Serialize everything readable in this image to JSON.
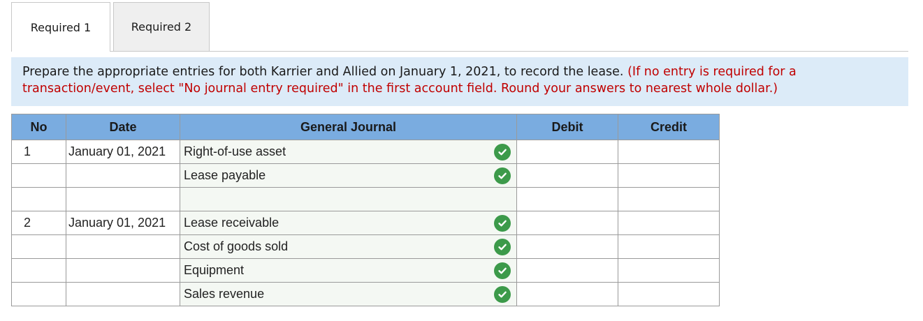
{
  "tabs": [
    {
      "label": "Required 1",
      "active": true
    },
    {
      "label": "Required 2",
      "active": false
    }
  ],
  "instructions": {
    "text": "Prepare the appropriate entries for both Karrier and Allied on January 1, 2021, to record the lease.",
    "note": "(If no entry is required for a transaction/event, select \"No journal entry required\" in the first account field. Round your answers to nearest whole dollar.)"
  },
  "table": {
    "headers": {
      "no": "No",
      "date": "Date",
      "journal": "General Journal",
      "debit": "Debit",
      "credit": "Credit"
    },
    "rows": [
      {
        "no": "1",
        "date": "January 01, 2021",
        "account": "Right-of-use asset",
        "debit": "",
        "credit": "",
        "checked": true
      },
      {
        "no": "",
        "date": "",
        "account": "Lease payable",
        "debit": "",
        "credit": "",
        "checked": true
      },
      {
        "no": "",
        "date": "",
        "account": "",
        "debit": "",
        "credit": "",
        "checked": false
      },
      {
        "no": "2",
        "date": "January 01, 2021",
        "account": "Lease receivable",
        "debit": "",
        "credit": "",
        "checked": true
      },
      {
        "no": "",
        "date": "",
        "account": "Cost of goods sold",
        "debit": "",
        "credit": "",
        "checked": true
      },
      {
        "no": "",
        "date": "",
        "account": "Equipment",
        "debit": "",
        "credit": "",
        "checked": true
      },
      {
        "no": "",
        "date": "",
        "account": "Sales revenue",
        "debit": "",
        "credit": "",
        "checked": true
      }
    ]
  },
  "icons": {
    "check": "check-circle-icon"
  },
  "colors": {
    "header_bg": "#7aace0",
    "instructions_bg": "#dcebf8",
    "note_text": "#c00000",
    "check": "#3c9a4a"
  }
}
